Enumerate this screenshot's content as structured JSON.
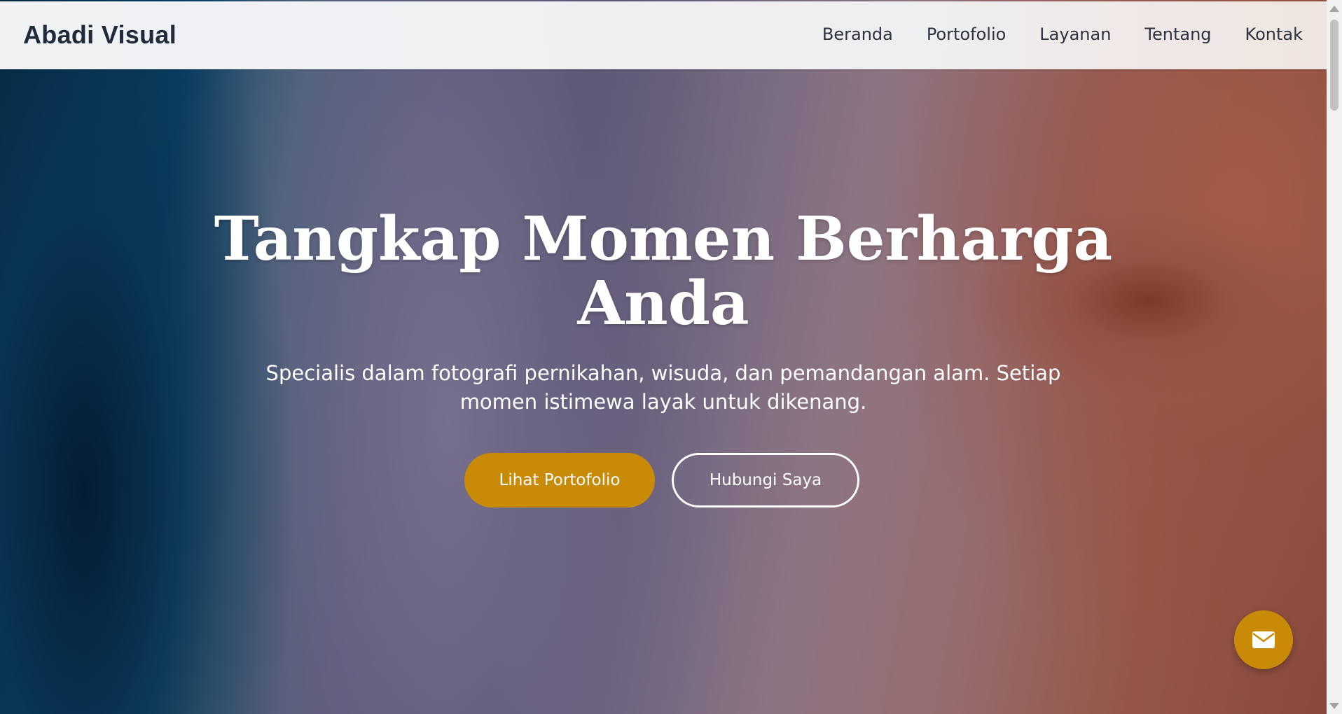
{
  "header": {
    "brand": "Abadi Visual",
    "nav": [
      {
        "label": "Beranda"
      },
      {
        "label": "Portofolio"
      },
      {
        "label": "Layanan"
      },
      {
        "label": "Tentang"
      },
      {
        "label": "Kontak"
      }
    ]
  },
  "hero": {
    "title": "Tangkap Momen Berharga Anda",
    "subtitle": "Specialis dalam fotografi pernikahan, wisuda, dan pemandangan alam. Setiap momen istimewa layak untuk dikenang.",
    "primary_button": "Lihat Portofolio",
    "secondary_button": "Hubungi Saya"
  },
  "fab": {
    "icon": "envelope-icon"
  },
  "colors": {
    "accent": "#c98a07",
    "brand_text": "#1f2a3a",
    "header_bg": "#f4f5f7"
  }
}
